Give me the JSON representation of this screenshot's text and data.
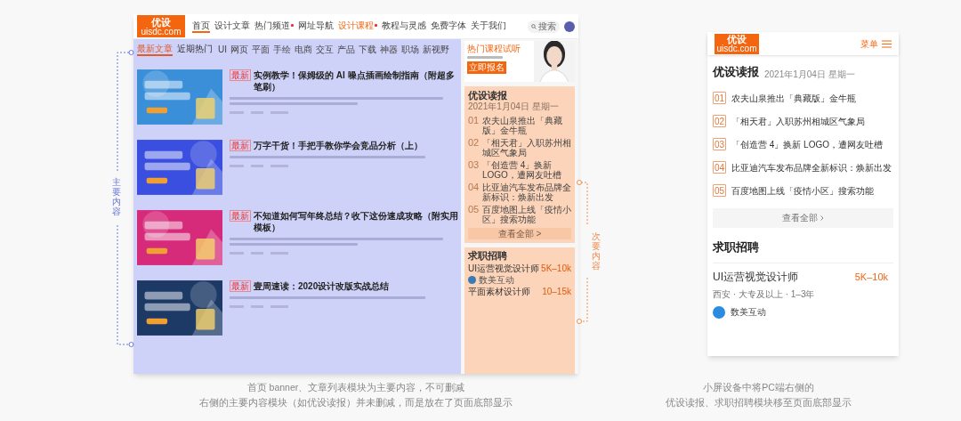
{
  "main_label": "主要内容",
  "secondary_label": "次要内容",
  "desktop": {
    "logo": "优设",
    "logo_sub": "uisdc.com",
    "nav": [
      {
        "label": "首页",
        "selected": true,
        "hot": false,
        "accent": false
      },
      {
        "label": "设计文章",
        "selected": false,
        "hot": false,
        "accent": false
      },
      {
        "label": "热门频道",
        "selected": false,
        "hot": true,
        "accent": false
      },
      {
        "label": "网址导航",
        "selected": false,
        "hot": false,
        "accent": false
      },
      {
        "label": "设计课程",
        "selected": false,
        "hot": true,
        "accent": true
      },
      {
        "label": "教程与灵感",
        "selected": false,
        "hot": false,
        "accent": false
      },
      {
        "label": "免费字体",
        "selected": false,
        "hot": false,
        "accent": false
      },
      {
        "label": "关于我们",
        "selected": false,
        "hot": false,
        "accent": false
      }
    ],
    "search": "搜索",
    "tabs": [
      {
        "label": "最新文章",
        "selected": true
      },
      {
        "label": "近期热门",
        "selected": false
      }
    ],
    "categories": [
      "UI",
      "网页",
      "平面",
      "手绘",
      "电商",
      "交互",
      "产品",
      "下载",
      "神器",
      "职场",
      "新视野"
    ],
    "articles": [
      {
        "badge": "最新",
        "title": "实例教学！保姆级的 AI 噪点插画绘制指南（附超多笔刷）",
        "color": "#3a8fd8"
      },
      {
        "badge": "最新",
        "title": "万字干货！手把手教你学会竞品分析（上）",
        "color": "#3a4fe0"
      },
      {
        "badge": "最新",
        "title": "不知道如何写年终总结？收下这份速成攻略（附实用模板）",
        "color": "#d62b7a"
      },
      {
        "badge": "最新",
        "title": "壹周速读：2020设计改版实战总结",
        "color": "#1d3a66"
      }
    ],
    "promo": {
      "title": "热门课程试听",
      "button": "立即报名"
    },
    "news": {
      "title": "优设读报",
      "date": "2021年1月04日 星期一",
      "items": [
        {
          "num": "01",
          "text": "农夫山泉推出「典藏版」金牛瓶"
        },
        {
          "num": "02",
          "text": "「相天君」入职苏州相城区气象局"
        },
        {
          "num": "03",
          "text": "「创造营 4」换新 LOGO，遭网友吐槽"
        },
        {
          "num": "04",
          "text": "比亚迪汽车发布品牌全新标识：焕新出发"
        },
        {
          "num": "05",
          "text": "百度地图上线「疫情小区」搜索功能"
        }
      ],
      "more": "查看全部 >"
    },
    "jobs": {
      "title": "求职招聘",
      "items": [
        {
          "title": "UI运营视觉设计师",
          "salary": "5K–10k",
          "company": "数美互动"
        },
        {
          "title": "平面素材设计师",
          "salary": "10–15k"
        }
      ]
    }
  },
  "mobile": {
    "logo": "优设",
    "logo_sub": "uisdc.com",
    "menu": "菜单",
    "news": {
      "title": "优设读报",
      "date": "2021年1月04日 星期一",
      "items": [
        {
          "num": "01",
          "text": "农夫山泉推出「典藏版」金牛瓶"
        },
        {
          "num": "02",
          "text": "「相天君」入职苏州相城区气象局"
        },
        {
          "num": "03",
          "text": "「创造营 4」换新 LOGO，遭网友吐槽"
        },
        {
          "num": "04",
          "text": "比亚迪汽车发布品牌全新标识：焕新出发"
        },
        {
          "num": "05",
          "text": "百度地图上线「疫情小区」搜索功能"
        }
      ],
      "more": "查看全部"
    },
    "jobs": {
      "title": "求职招聘",
      "items": [
        {
          "title": "UI运营视觉设计师",
          "salary": "5K–10k",
          "meta": "西安 · 大专及以上 · 1–3年",
          "company": "数美互动"
        }
      ]
    }
  },
  "captions": {
    "left": [
      "首页 banner、文章列表模块为主要内容，不可删减",
      "右侧的主要内容模块（如优设读报）并未删减，而是放在了页面底部显示"
    ],
    "right": [
      "小屏设备中将PC端右侧的",
      "优设读报、求职招聘模块移至页面底部显示"
    ]
  }
}
